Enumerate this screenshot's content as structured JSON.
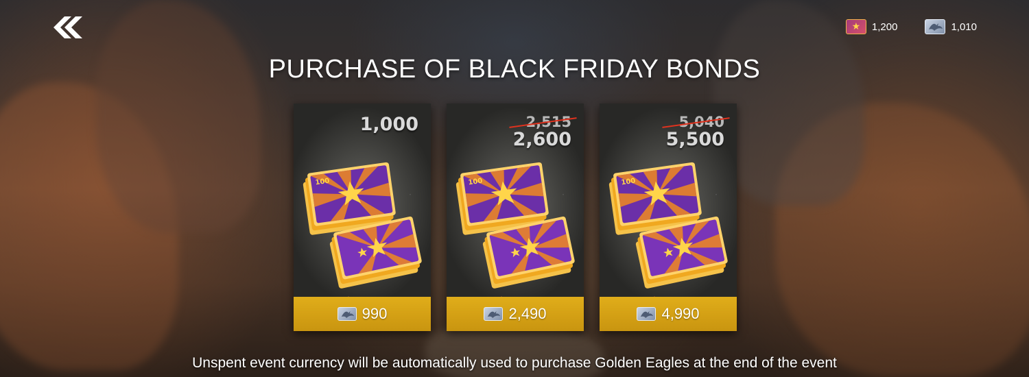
{
  "header": {
    "title": "PURCHASE OF BLACK FRIDAY BONDS"
  },
  "currencies": [
    {
      "icon": "bond-icon",
      "value": "1,200"
    },
    {
      "icon": "golden-eagle-icon",
      "value": "1,010"
    }
  ],
  "offers": [
    {
      "old_amount": "",
      "amount": "1,000",
      "price": "990",
      "price_icon": "golden-eagle-icon"
    },
    {
      "old_amount": "2,515",
      "amount": "2,600",
      "price": "2,490",
      "price_icon": "golden-eagle-icon"
    },
    {
      "old_amount": "5,040",
      "amount": "5,500",
      "price": "4,990",
      "price_icon": "golden-eagle-icon"
    }
  ],
  "footer": {
    "note": "Unspent event currency will be automatically used to purchase Golden Eagles at the end of the event"
  },
  "colors": {
    "price_button": "#d6a316",
    "strike": "#e0321e",
    "bond_purple": "#6b2fa8",
    "bond_orange": "#f08a1e"
  }
}
